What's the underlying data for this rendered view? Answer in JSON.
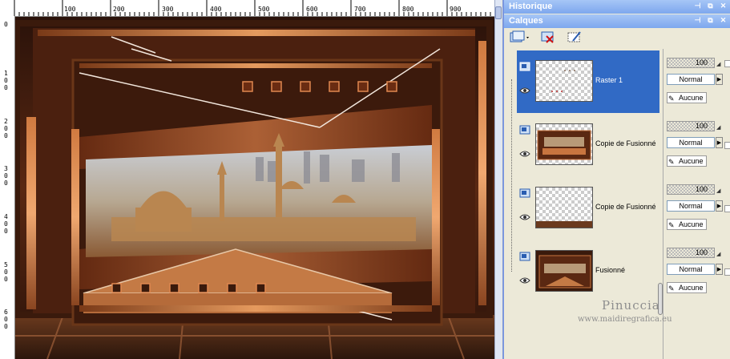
{
  "canvas": {
    "ruler_top_labels": [
      "100",
      "200",
      "300",
      "400",
      "500",
      "600",
      "700",
      "800",
      "900"
    ],
    "ruler_left_labels": [
      "0",
      "1\n0\n0",
      "2\n0\n0",
      "3\n0\n0",
      "4\n0\n0",
      "5\n0\n0",
      "6\n0\n0"
    ]
  },
  "palettes": {
    "history_title": "Historique",
    "layers_title": "Calques"
  },
  "layers": [
    {
      "name": "Raster 1",
      "selected": true,
      "opacity": "100",
      "blend": "Normal",
      "mask": "Aucune"
    },
    {
      "name": "Copie de Fusionné",
      "selected": false,
      "opacity": "100",
      "blend": "Normal",
      "mask": "Aucune"
    },
    {
      "name": "Copie de Fusionné",
      "selected": false,
      "opacity": "100",
      "blend": "Normal",
      "mask": "Aucune"
    },
    {
      "name": "Fusionné",
      "selected": false,
      "opacity": "100",
      "blend": "Normal",
      "mask": "Aucune"
    }
  ],
  "watermark": {
    "name": "Pinuccia",
    "url": "www.maidiregrafica.eu"
  },
  "icons": {
    "history_pin": "pin-icon",
    "history_float": "float-window-icon",
    "history_close": "close-icon",
    "new_layer": "new-layer-icon",
    "delete_layer": "delete-layer-icon",
    "edit_layer": "layer-properties-icon",
    "visibility": "eye-icon"
  },
  "colors": {
    "selection": "#316ac5",
    "palette_bg": "#ece9d8",
    "title_gradient_top": "#a6c6f6",
    "art_copper": "#c8753f",
    "art_dark": "#3a1a0c"
  }
}
